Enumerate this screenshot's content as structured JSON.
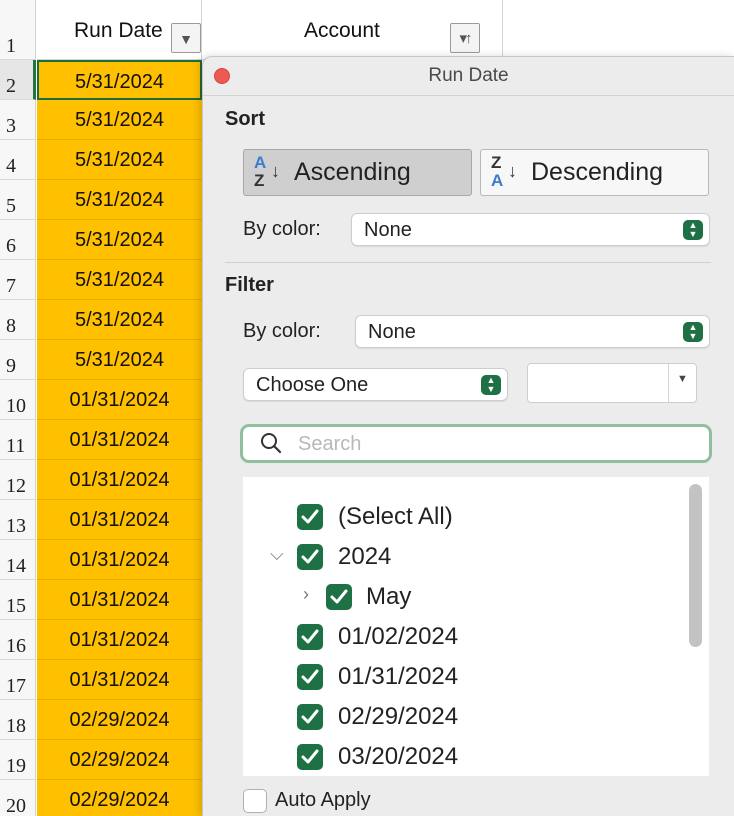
{
  "sheet": {
    "row_numbers": [
      "1",
      "2",
      "3",
      "4",
      "5",
      "6",
      "7",
      "8",
      "9",
      "10",
      "11",
      "12",
      "13",
      "14",
      "15",
      "16",
      "17",
      "18",
      "19",
      "20"
    ],
    "headers": {
      "col_a": "Run Date",
      "col_b": "Account"
    },
    "col_a_values": [
      "5/31/2024",
      "5/31/2024",
      "5/31/2024",
      "5/31/2024",
      "5/31/2024",
      "5/31/2024",
      "5/31/2024",
      "5/31/2024",
      "01/31/2024",
      "01/31/2024",
      "01/31/2024",
      "01/31/2024",
      "01/31/2024",
      "01/31/2024",
      "01/31/2024",
      "01/31/2024",
      "02/29/2024",
      "02/29/2024",
      "02/29/2024"
    ],
    "fill_color": "#FFC000"
  },
  "popover": {
    "title": "Run Date",
    "sort": {
      "label": "Sort",
      "ascending": "Ascending",
      "descending": "Descending",
      "asc_glyph": {
        "top": "A",
        "bottom": "Z"
      },
      "desc_glyph": {
        "top": "Z",
        "bottom": "A"
      },
      "by_color_label": "By color:",
      "by_color_value": "None"
    },
    "filter": {
      "label": "Filter",
      "by_color_label": "By color:",
      "by_color_value": "None",
      "condition_value": "Choose One",
      "condition_input": ""
    },
    "search": {
      "placeholder": "Search",
      "value": ""
    },
    "list_items": [
      {
        "label": "(Select All)",
        "checked": true
      },
      {
        "label": "2024",
        "checked": true,
        "disclosure": "expanded"
      },
      {
        "label": "May",
        "checked": true,
        "disclosure": "collapsed"
      },
      {
        "label": "01/02/2024",
        "checked": true
      },
      {
        "label": "01/31/2024",
        "checked": true
      },
      {
        "label": "02/29/2024",
        "checked": true
      },
      {
        "label": "03/20/2024",
        "checked": true
      }
    ],
    "auto_apply": {
      "label": "Auto Apply",
      "checked": false
    },
    "colors": {
      "accent": "#1E7145",
      "close": "#EE5A52"
    }
  }
}
